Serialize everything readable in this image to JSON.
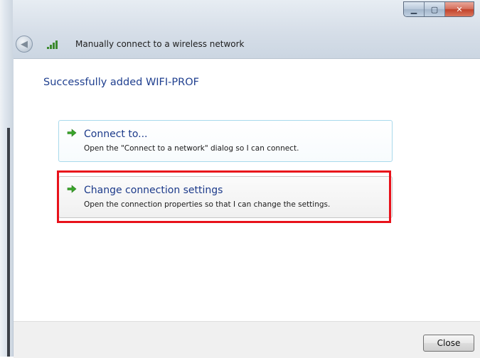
{
  "window": {
    "title": "Manually connect to a wireless network",
    "controls": {
      "minimize_icon": "minimize-icon",
      "maximize_icon": "maximize-icon",
      "close_icon": "close-icon"
    }
  },
  "main": {
    "heading": "Successfully added WIFI-PROF",
    "options": [
      {
        "title": "Connect to...",
        "description": "Open the \"Connect to a network\" dialog so I can connect.",
        "icon": "green-arrow-icon"
      },
      {
        "title": "Change connection settings",
        "description": "Open the connection properties so that I can change the settings.",
        "icon": "green-arrow-icon",
        "highlighted": true
      }
    ]
  },
  "footer": {
    "close_label": "Close"
  },
  "colors": {
    "heading": "#1f3f8f",
    "link_title": "#1c3a8a",
    "highlight": "#e8121b",
    "arrow": "#3aa62a"
  }
}
